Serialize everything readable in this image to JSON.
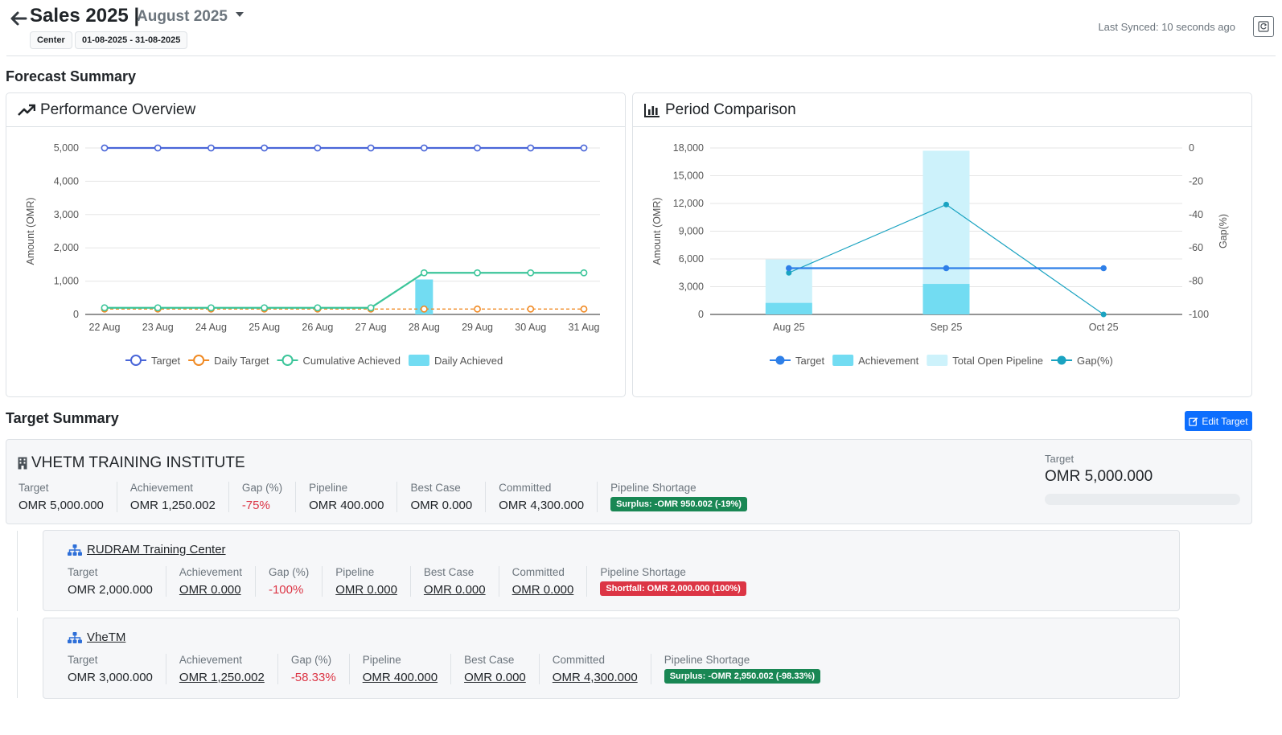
{
  "header": {
    "title": "Sales 2025 |",
    "month": "August 2025",
    "chips": [
      "Center",
      "01-08-2025 - 31-08-2025"
    ],
    "last_synced": "Last Synced: 10 seconds ago"
  },
  "forecast": {
    "title": "Forecast Summary",
    "performance_title": "Performance Overview",
    "comparison_title": "Period Comparison"
  },
  "colors": {
    "target": "#4a66d8",
    "daily_target": "#f08a24",
    "cumulative": "#3cc59a",
    "daily_achieved": "#72dcf2",
    "pipeline": "#cdf2fb",
    "gap": "#1aa3c1",
    "target_comp": "#2e7fe8"
  },
  "chart_data": [
    {
      "type": "line",
      "title": "Performance Overview",
      "xlabel": "",
      "ylabel": "Amount (OMR)",
      "categories": [
        "22 Aug",
        "23 Aug",
        "24 Aug",
        "25 Aug",
        "26 Aug",
        "27 Aug",
        "28 Aug",
        "29 Aug",
        "30 Aug",
        "31 Aug"
      ],
      "ylim": [
        0,
        5000
      ],
      "yticks": [
        0,
        1000,
        2000,
        3000,
        4000,
        5000
      ],
      "ytick_labels": [
        "0",
        "1,000",
        "2,000",
        "3,000",
        "4,000",
        "5,000"
      ],
      "grid": true,
      "legend": "bottom",
      "series": [
        {
          "name": "Target",
          "type": "line",
          "values": [
            5000,
            5000,
            5000,
            5000,
            5000,
            5000,
            5000,
            5000,
            5000,
            5000
          ]
        },
        {
          "name": "Daily Target",
          "type": "line-dashed",
          "values": [
            161.29,
            161.29,
            161.29,
            161.29,
            161.29,
            161.29,
            161.29,
            161.29,
            161.29,
            161.29
          ]
        },
        {
          "name": "Cumulative Achieved",
          "type": "line",
          "values": [
            200,
            200,
            200,
            200,
            200,
            200,
            1250,
            1250,
            1250,
            1250
          ]
        },
        {
          "name": "Daily Achieved",
          "type": "bar",
          "values": [
            0,
            0,
            0,
            0,
            0,
            0,
            1050,
            0,
            0,
            0
          ]
        }
      ]
    },
    {
      "type": "bar",
      "title": "Period Comparison",
      "xlabel": "",
      "ylabel": "Amount (OMR)",
      "y2label": "Gap(%)",
      "categories": [
        "Aug 25",
        "Sep 25",
        "Oct 25"
      ],
      "ylim": [
        0,
        18000
      ],
      "yticks": [
        0,
        3000,
        6000,
        9000,
        12000,
        15000,
        18000
      ],
      "ytick_labels": [
        "0",
        "3,000",
        "6,000",
        "9,000",
        "12,000",
        "15,000",
        "18,000"
      ],
      "y2lim": [
        -100,
        0
      ],
      "y2ticks": [
        0,
        -20,
        -40,
        -60,
        -80,
        -100
      ],
      "y2tick_labels": [
        "0",
        "-20",
        "-40",
        "-60",
        "-80",
        "-100"
      ],
      "grid": true,
      "legend": "bottom",
      "series": [
        {
          "name": "Target",
          "type": "line",
          "axis": "left",
          "values": [
            5000,
            5000,
            5000
          ]
        },
        {
          "name": "Achievement",
          "type": "bar",
          "axis": "left",
          "values": [
            1250,
            3300,
            0
          ]
        },
        {
          "name": "Total Open Pipeline",
          "type": "bar",
          "axis": "left",
          "values": [
            4700,
            14400,
            0
          ]
        },
        {
          "name": "Gap(%)",
          "type": "line",
          "axis": "right",
          "values": [
            -75,
            -34,
            -100
          ]
        }
      ]
    }
  ],
  "target_summary": {
    "title": "Target Summary",
    "edit_label": "Edit Target",
    "org": {
      "name": "VHETM TRAINING INSTITUTE",
      "metrics": [
        {
          "label": "Target",
          "value": "OMR 5,000.000"
        },
        {
          "label": "Achievement",
          "value": "OMR 1,250.002"
        },
        {
          "label": "Gap (%)",
          "value": "-75%"
        },
        {
          "label": "Pipeline",
          "value": "OMR 400.000"
        },
        {
          "label": "Best Case",
          "value": "OMR 0.000"
        },
        {
          "label": "Committed",
          "value": "OMR 4,300.000"
        }
      ],
      "shortage_label": "Pipeline Shortage",
      "shortage_badge": "Surplus: -OMR 950.002 (-19%)",
      "side_label": "Target",
      "side_value": "OMR 5,000.000",
      "progress": 0
    },
    "children": [
      {
        "name": "RUDRAM Training Center",
        "metrics": [
          {
            "label": "Target",
            "value": "OMR 2,000.000"
          },
          {
            "label": "Achievement",
            "value": "OMR 0.000"
          },
          {
            "label": "Gap (%)",
            "value": "-100%"
          },
          {
            "label": "Pipeline",
            "value": "OMR 0.000"
          },
          {
            "label": "Best Case",
            "value": "OMR 0.000"
          },
          {
            "label": "Committed",
            "value": "OMR 0.000"
          }
        ],
        "shortage_label": "Pipeline Shortage",
        "shortage_badge": "Shortfall: OMR 2,000.000 (100%)"
      },
      {
        "name": "VheTM",
        "metrics": [
          {
            "label": "Target",
            "value": "OMR 3,000.000"
          },
          {
            "label": "Achievement",
            "value": "OMR 1,250.002"
          },
          {
            "label": "Gap (%)",
            "value": "-58.33%"
          },
          {
            "label": "Pipeline",
            "value": "OMR 400.000"
          },
          {
            "label": "Best Case",
            "value": "OMR 0.000"
          },
          {
            "label": "Committed",
            "value": "OMR 4,300.000"
          }
        ],
        "shortage_label": "Pipeline Shortage",
        "shortage_badge": "Surplus: -OMR 2,950.002 (-98.33%)"
      }
    ]
  }
}
